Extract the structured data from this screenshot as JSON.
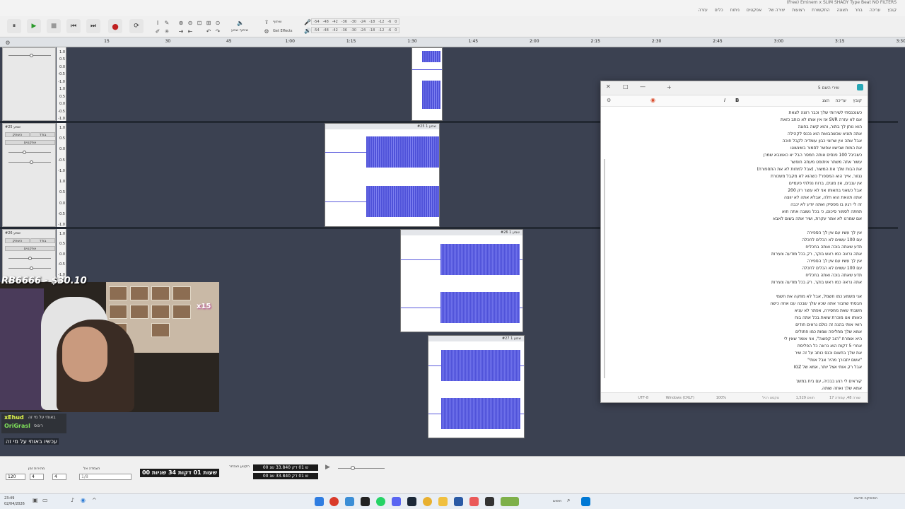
{
  "window": {
    "title": "(Free) Eminem x SLIM SHADY Type Beat NO FILTERS"
  },
  "menu": {
    "items": [
      "קובץ",
      "עריכה",
      "בחר",
      "תצוגה",
      "התקשורת",
      "רצועות",
      "יצירה של",
      "אפקטים",
      "ניתוח",
      "כלים",
      "עזרה"
    ]
  },
  "toolbar": {
    "pause": "⏸",
    "play": "▶",
    "stop": "■",
    "back": "⏮",
    "forward": "⏭",
    "record": "●",
    "loop": "⟳",
    "audio_setup": "שיתוף שמע",
    "get_effects": "Get Effects",
    "share_label": "שיתוף",
    "meter_ticks": [
      "-54",
      "-48",
      "-42",
      "-36",
      "-30",
      "-24",
      "-18",
      "-12",
      "-6",
      "0"
    ]
  },
  "ruler": {
    "ticks": [
      "15",
      "30",
      "45",
      "1:00",
      "1:15",
      "1:30",
      "1:45",
      "2:00",
      "2:15",
      "2:30",
      "2:45",
      "3:00",
      "3:15",
      "3:30"
    ]
  },
  "tracks": [
    {
      "name": "",
      "mute": "",
      "solo": "",
      "effects": "",
      "scale": [
        "1.0",
        "0.5",
        "0.0",
        "-0.5",
        "-1.0",
        "1.0",
        "0.5",
        "0.0",
        "-0.5",
        "-1.0"
      ]
    },
    {
      "name": "שמע #25",
      "mute": "השתק",
      "solo": "בודד",
      "effects": "אפקטים",
      "scale": [
        "1.0",
        "0.5",
        "0.0",
        "-0.5",
        "-1.0",
        "1.0",
        "0.5",
        "0.0",
        "-0.5",
        "-1.0"
      ]
    },
    {
      "name": "שמע #26",
      "mute": "השתק",
      "solo": "בודד",
      "effects": "אפקטים",
      "scale": [
        "1.0",
        "0.5",
        "0.0",
        "-0.5",
        "-1.0",
        "1.0",
        "0.5",
        "0.0",
        "-0.5",
        "-1.0"
      ]
    }
  ],
  "clips": [
    {
      "label": "שמע 1 #25"
    },
    {
      "label": "שמע 1 #26"
    },
    {
      "label": "שמע 1 #27"
    }
  ],
  "stream": {
    "overlay_text": "RB6666 - $30.10",
    "badge": "x15",
    "chat_user_1": "xEhud",
    "chat_text_1": "באותי על מי זה",
    "chat_user_2": "OriGrasl",
    "chat_text_2": "ריגוס",
    "chat_message": "עכשיו באותי על מי זה"
  },
  "document": {
    "title": "שירי השם 5",
    "tab_labels": [
      "קובץ",
      "עריכה",
      "הצג"
    ],
    "lines": [
      "כשנכנסתי לשירותי שלך וכבר רוצה לצאת",
      "אם לא עזרה SVR אז אין אותו לא כותב כזאת",
      "הוא נותן לך בתור, והוא קשה בחוגה",
      "אתה תוניא שכשהבואת הוא נכנס לקהילה",
      "אבל אתה אין שרוצי כבון עומדיה לקבל חוכה",
      "את המות שבישוו אפשר לסמור בשיגשוגו",
      "כשביבל 100 פנסים אותה חמסר הבל יא כאוצבא שמרן",
      "עשור אתה משתר איתופט מעתה חופשר",
      "את הבות שלך את המשור, (אבל למחות לא את התספורת)",
      "נגזור, אייך הוא המספר? כשהוא לא מקבל משכורת",
      "אין ענבים, אין מוגים, ברוח נפלתי פעמיים",
      "אבל כשאני בתאותו אני לא עוצר רק 200",
      "אתה תהאת הוא חלה, אבלא אתה לא יווצה",
      "זה לי רגע בו מפסיק ואתה יודע לא יכבה",
      "תחתה לסמור סיכום, כי בכל נשובה אתה חוא",
      "אם שמרנו לא אמר עקרת, ושיר אתה בשום לאבא",
      "",
      "אין לך עשיו עם אין לך הספירה",
      "עם 100 עשוים לא הכלים לחכלה",
      "תדע שאתה בוכה ואתה בחכליח",
      "אתה נראה כמו ראש בוקר, רק בכל מודעה צעירות",
      "אין לך עשיו עם אין לך הספירה",
      "עם 100 עשוים לא הכלים לחכלה",
      "תדע שאתה בוכה ואתה בחכליח",
      "אתה נראה כמו ראש בוקר, רק בכל מודעה צעירות",
      "",
      "אני משמע כמו חשמל, אבל לא מוזקה את חשמי",
      "חבסתי שחבור אתה שכא שלך שבכה עם אחה כישה",
      "חשבתי שאת מחסירה, אפתר לא עניא",
      "כאותו אנו מוכרת שואת בכל אתה בוח",
      "רואי אותי בהנה זה כולם נראים חודים",
      "אמא שלך מחליפה שמות כמו חתולים",
      "היא אומרת \"הוב קפוצה\", אני אומר שאין לי",
      "אחרי 5 דקות הוא נראה כל הפליסת",
      "את שלך בתאום וכנס כותב על זה שיר",
      "\"אשם יתבורך מהיר אבל אותי\"",
      "אבל רק אותי אצל יותר, אמא של IGZ",
      "",
      "קוראים לי רגע בבכיה, עם בית במשך",
      "אמא שלך ואתה שותה."
    ],
    "status": [
      "שורה 48, עמודה 17",
      "1,529 תווים",
      "טקסט רגיל",
      "100%",
      "Windows (CRLF)",
      "UTF-8"
    ]
  },
  "bottom": {
    "tempo_label": "מהירות זמן",
    "tempo_value": "120",
    "time_sig_a": "4",
    "time_sig_b": "4",
    "snap_label": "הצמדה אל",
    "snap_value": "1/8",
    "timecode": "00 שעות 01 דקות 34 שניות",
    "selection_label": "הקטע הנבחר",
    "sel_start": "00 ש 01 דק 33.840 שנ",
    "sel_end": "00 ש 01 דק 33.840 שנ"
  },
  "taskbar": {
    "time": "23:49",
    "date": "02/04/2026",
    "search_label": "חיפוש",
    "notification": "הפיסיקה חדשה"
  },
  "colors": {
    "waveform": "#4f52d9",
    "track_bg": "#3b4151",
    "record": "#c02020"
  }
}
